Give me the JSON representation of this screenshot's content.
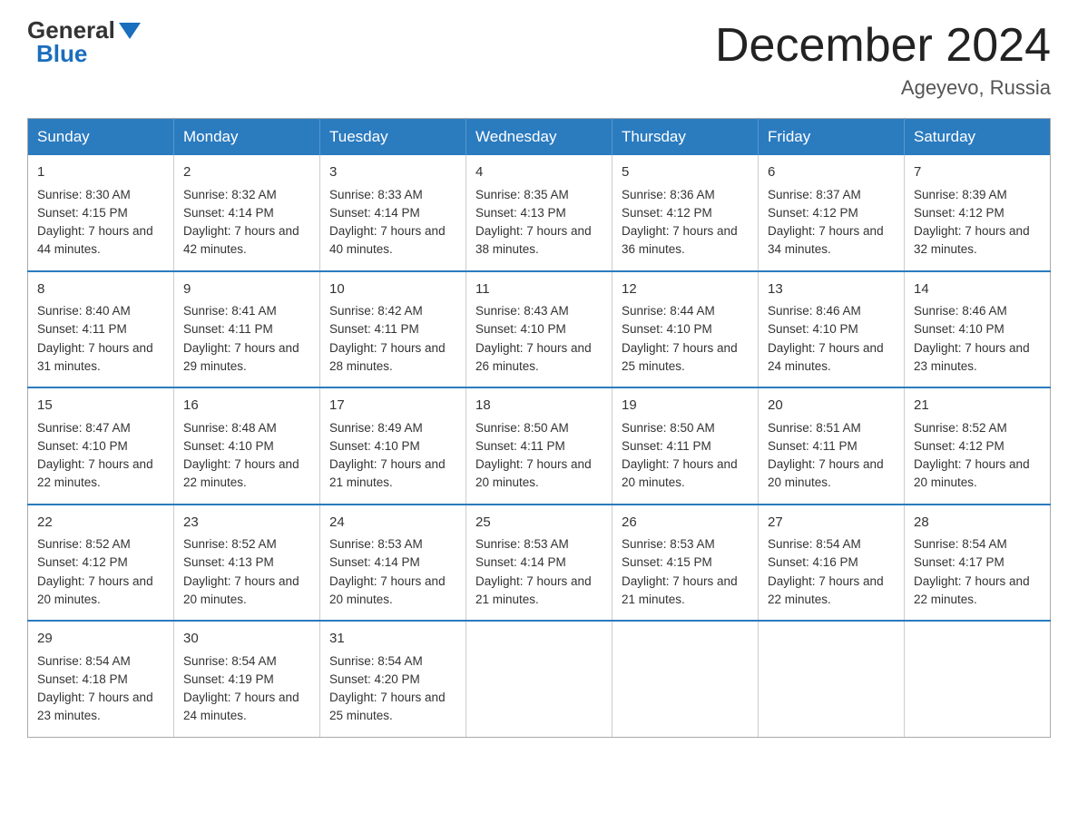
{
  "logo": {
    "general": "General",
    "blue": "Blue"
  },
  "title": "December 2024",
  "location": "Ageyevo, Russia",
  "days_of_week": [
    "Sunday",
    "Monday",
    "Tuesday",
    "Wednesday",
    "Thursday",
    "Friday",
    "Saturday"
  ],
  "weeks": [
    [
      {
        "day": "1",
        "sunrise": "Sunrise: 8:30 AM",
        "sunset": "Sunset: 4:15 PM",
        "daylight": "Daylight: 7 hours and 44 minutes."
      },
      {
        "day": "2",
        "sunrise": "Sunrise: 8:32 AM",
        "sunset": "Sunset: 4:14 PM",
        "daylight": "Daylight: 7 hours and 42 minutes."
      },
      {
        "day": "3",
        "sunrise": "Sunrise: 8:33 AM",
        "sunset": "Sunset: 4:14 PM",
        "daylight": "Daylight: 7 hours and 40 minutes."
      },
      {
        "day": "4",
        "sunrise": "Sunrise: 8:35 AM",
        "sunset": "Sunset: 4:13 PM",
        "daylight": "Daylight: 7 hours and 38 minutes."
      },
      {
        "day": "5",
        "sunrise": "Sunrise: 8:36 AM",
        "sunset": "Sunset: 4:12 PM",
        "daylight": "Daylight: 7 hours and 36 minutes."
      },
      {
        "day": "6",
        "sunrise": "Sunrise: 8:37 AM",
        "sunset": "Sunset: 4:12 PM",
        "daylight": "Daylight: 7 hours and 34 minutes."
      },
      {
        "day": "7",
        "sunrise": "Sunrise: 8:39 AM",
        "sunset": "Sunset: 4:12 PM",
        "daylight": "Daylight: 7 hours and 32 minutes."
      }
    ],
    [
      {
        "day": "8",
        "sunrise": "Sunrise: 8:40 AM",
        "sunset": "Sunset: 4:11 PM",
        "daylight": "Daylight: 7 hours and 31 minutes."
      },
      {
        "day": "9",
        "sunrise": "Sunrise: 8:41 AM",
        "sunset": "Sunset: 4:11 PM",
        "daylight": "Daylight: 7 hours and 29 minutes."
      },
      {
        "day": "10",
        "sunrise": "Sunrise: 8:42 AM",
        "sunset": "Sunset: 4:11 PM",
        "daylight": "Daylight: 7 hours and 28 minutes."
      },
      {
        "day": "11",
        "sunrise": "Sunrise: 8:43 AM",
        "sunset": "Sunset: 4:10 PM",
        "daylight": "Daylight: 7 hours and 26 minutes."
      },
      {
        "day": "12",
        "sunrise": "Sunrise: 8:44 AM",
        "sunset": "Sunset: 4:10 PM",
        "daylight": "Daylight: 7 hours and 25 minutes."
      },
      {
        "day": "13",
        "sunrise": "Sunrise: 8:46 AM",
        "sunset": "Sunset: 4:10 PM",
        "daylight": "Daylight: 7 hours and 24 minutes."
      },
      {
        "day": "14",
        "sunrise": "Sunrise: 8:46 AM",
        "sunset": "Sunset: 4:10 PM",
        "daylight": "Daylight: 7 hours and 23 minutes."
      }
    ],
    [
      {
        "day": "15",
        "sunrise": "Sunrise: 8:47 AM",
        "sunset": "Sunset: 4:10 PM",
        "daylight": "Daylight: 7 hours and 22 minutes."
      },
      {
        "day": "16",
        "sunrise": "Sunrise: 8:48 AM",
        "sunset": "Sunset: 4:10 PM",
        "daylight": "Daylight: 7 hours and 22 minutes."
      },
      {
        "day": "17",
        "sunrise": "Sunrise: 8:49 AM",
        "sunset": "Sunset: 4:10 PM",
        "daylight": "Daylight: 7 hours and 21 minutes."
      },
      {
        "day": "18",
        "sunrise": "Sunrise: 8:50 AM",
        "sunset": "Sunset: 4:11 PM",
        "daylight": "Daylight: 7 hours and 20 minutes."
      },
      {
        "day": "19",
        "sunrise": "Sunrise: 8:50 AM",
        "sunset": "Sunset: 4:11 PM",
        "daylight": "Daylight: 7 hours and 20 minutes."
      },
      {
        "day": "20",
        "sunrise": "Sunrise: 8:51 AM",
        "sunset": "Sunset: 4:11 PM",
        "daylight": "Daylight: 7 hours and 20 minutes."
      },
      {
        "day": "21",
        "sunrise": "Sunrise: 8:52 AM",
        "sunset": "Sunset: 4:12 PM",
        "daylight": "Daylight: 7 hours and 20 minutes."
      }
    ],
    [
      {
        "day": "22",
        "sunrise": "Sunrise: 8:52 AM",
        "sunset": "Sunset: 4:12 PM",
        "daylight": "Daylight: 7 hours and 20 minutes."
      },
      {
        "day": "23",
        "sunrise": "Sunrise: 8:52 AM",
        "sunset": "Sunset: 4:13 PM",
        "daylight": "Daylight: 7 hours and 20 minutes."
      },
      {
        "day": "24",
        "sunrise": "Sunrise: 8:53 AM",
        "sunset": "Sunset: 4:14 PM",
        "daylight": "Daylight: 7 hours and 20 minutes."
      },
      {
        "day": "25",
        "sunrise": "Sunrise: 8:53 AM",
        "sunset": "Sunset: 4:14 PM",
        "daylight": "Daylight: 7 hours and 21 minutes."
      },
      {
        "day": "26",
        "sunrise": "Sunrise: 8:53 AM",
        "sunset": "Sunset: 4:15 PM",
        "daylight": "Daylight: 7 hours and 21 minutes."
      },
      {
        "day": "27",
        "sunrise": "Sunrise: 8:54 AM",
        "sunset": "Sunset: 4:16 PM",
        "daylight": "Daylight: 7 hours and 22 minutes."
      },
      {
        "day": "28",
        "sunrise": "Sunrise: 8:54 AM",
        "sunset": "Sunset: 4:17 PM",
        "daylight": "Daylight: 7 hours and 22 minutes."
      }
    ],
    [
      {
        "day": "29",
        "sunrise": "Sunrise: 8:54 AM",
        "sunset": "Sunset: 4:18 PM",
        "daylight": "Daylight: 7 hours and 23 minutes."
      },
      {
        "day": "30",
        "sunrise": "Sunrise: 8:54 AM",
        "sunset": "Sunset: 4:19 PM",
        "daylight": "Daylight: 7 hours and 24 minutes."
      },
      {
        "day": "31",
        "sunrise": "Sunrise: 8:54 AM",
        "sunset": "Sunset: 4:20 PM",
        "daylight": "Daylight: 7 hours and 25 minutes."
      },
      null,
      null,
      null,
      null
    ]
  ]
}
